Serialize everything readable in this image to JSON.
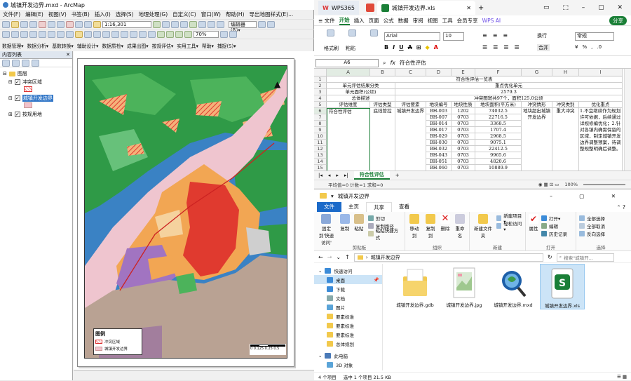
{
  "arcmap": {
    "title": "城镇开发边界.mxd - ArcMap",
    "menu": [
      "文件(F)",
      "编辑(E)",
      "视图(V)",
      "书签(B)",
      "插入(I)",
      "选择(S)",
      "地理处理(G)",
      "自定义(C)",
      "窗口(W)",
      "帮助(H)",
      "导出地图样式(E)..."
    ],
    "scale": "1:16,301",
    "editor_label": "编辑器(R)▾",
    "zoom_label": "70%",
    "toolbar3": [
      "数据管理▾",
      "数据分析▾",
      "基数转换▾",
      "辅助设计▾",
      "数据质检▾",
      "成果出图▾",
      "按规评估▾",
      "实用工具▾",
      "帮助▾",
      "捕捉(S)▾"
    ],
    "toc": {
      "header": "内容列表",
      "root": "图层",
      "layers": [
        "冲突区域",
        "城镇开发边界",
        "按规用地"
      ]
    },
    "legend": {
      "title": "图例",
      "items": [
        "冲突区域",
        "城镇开发边界"
      ]
    },
    "scalebar": "0  0.125 0.25       0.5"
  },
  "wps": {
    "tabs": [
      "WPS365",
      "城镇开发边界.xls"
    ],
    "menu": [
      "≡ 文件",
      "开始",
      "插入",
      "页面",
      "公式",
      "数据",
      "审阅",
      "视图",
      "工具",
      "会员专享",
      "WPS AI"
    ],
    "share_label": "分享",
    "ribbon": {
      "font": "Arial",
      "size": "10",
      "format": "常规",
      "labels": [
        "格式刷",
        "粘贴",
        "换行",
        "合并"
      ]
    },
    "cell_ref": "A6",
    "formula": "符合性评估",
    "columns": [
      "A",
      "B",
      "C",
      "D",
      "E",
      "F",
      "G",
      "H",
      "I"
    ],
    "rows": [
      [
        "1",
        "符合性评估一览表"
      ],
      [
        "2",
        "单元评估结果分类",
        "重点优化单元"
      ],
      [
        "3",
        "单元面积(公顷)",
        "2579.3"
      ],
      [
        "4",
        "总体描述",
        "冲突图斑共97个，面积125.0公顷"
      ],
      [
        "5",
        "评估维度",
        "评估类型",
        "评估要素",
        "地块编号",
        "地块性质",
        "地块面积(平方米)",
        "冲突情形",
        "冲突类别",
        "优化重点"
      ],
      [
        "6",
        "符合性评估",
        "底线管控",
        "城镇开发边界",
        "BH-003",
        "1202",
        "74032.5",
        "地块超出城镇开发边界",
        "重大冲突",
        "1.不宜继续作为规划许可依据，后续通过详规修编优化；2.针对各镇内确需保留的区域，制定城镇开发边界调整预案，待调整规整明确后调整。"
      ],
      [
        "7",
        "",
        "",
        "",
        "BH-007",
        "0703",
        "22716.5"
      ],
      [
        "8",
        "",
        "",
        "",
        "BH-014",
        "0703",
        "3368.5"
      ],
      [
        "9",
        "",
        "",
        "",
        "BH-017",
        "0703",
        "1707.4"
      ],
      [
        "10",
        "",
        "",
        "",
        "BH-029",
        "0703",
        "2968.5"
      ],
      [
        "11",
        "",
        "",
        "",
        "BH-030",
        "0703",
        "9075.1"
      ],
      [
        "12",
        "",
        "",
        "",
        "BH-032",
        "0703",
        "22412.5"
      ],
      [
        "13",
        "",
        "",
        "",
        "BH-043",
        "0703",
        "9965.6"
      ],
      [
        "14",
        "",
        "",
        "",
        "BH-051",
        "0703",
        "4820.6"
      ],
      [
        "15",
        "",
        "",
        "",
        "BH-060",
        "0703",
        "10889.9"
      ]
    ],
    "sheet_name": "符合性评估",
    "status": "平均值=0  计数=1  求和=0",
    "zoom": "100%"
  },
  "explorer": {
    "title": "城镇开发边界",
    "tabs": [
      "文件",
      "主页",
      "共享",
      "查看"
    ],
    "ribbon": {
      "clipboard": {
        "label": "剪贴板",
        "pin": "固定到'快速访问'",
        "copy": "复制",
        "paste": "粘贴",
        "cut": "剪切",
        "copy_path": "复制路径",
        "paste_shortcut": "粘贴快捷方式"
      },
      "organize": {
        "label": "组织",
        "move_to": "移动到",
        "copy_to": "复制到",
        "delete": "删除",
        "rename": "重命名"
      },
      "new": {
        "label": "新建",
        "new_folder": "新建文件夹",
        "new_item": "新建项目▾",
        "easy_access": "轻松访问▾"
      },
      "open": {
        "label": "打开",
        "properties": "属性",
        "open": "打开▾",
        "edit": "编辑",
        "history": "历史记录"
      },
      "select": {
        "label": "选择",
        "select_all": "全部选择",
        "select_none": "全部取消",
        "invert": "反向选择"
      }
    },
    "address": "城镇开发边界",
    "search_placeholder": "搜索\"城镇开...",
    "nav": [
      "快速访问",
      "桌面",
      "下载",
      "文档",
      "图片",
      "要素标准",
      "要素标准",
      "要素标准",
      "总体规划",
      "此电脑",
      "3D 对象"
    ],
    "files": [
      "城镇开发边界.gdb",
      "城镇开发边界.jpg",
      "城镇开发边界.mxd",
      "城镇开发边界.xls"
    ],
    "status": [
      "4 个项目",
      "选中 1 个项目  21.5 KB"
    ]
  },
  "colors": {
    "wps_green": "#1a7f37",
    "water": "#3a82c4",
    "forest": "#33a24b",
    "conflict_red": "#e03a2f",
    "orange": "#f2a653",
    "pink": "#efc5cf",
    "brown": "#b9a293",
    "purple": "#a174c1"
  }
}
